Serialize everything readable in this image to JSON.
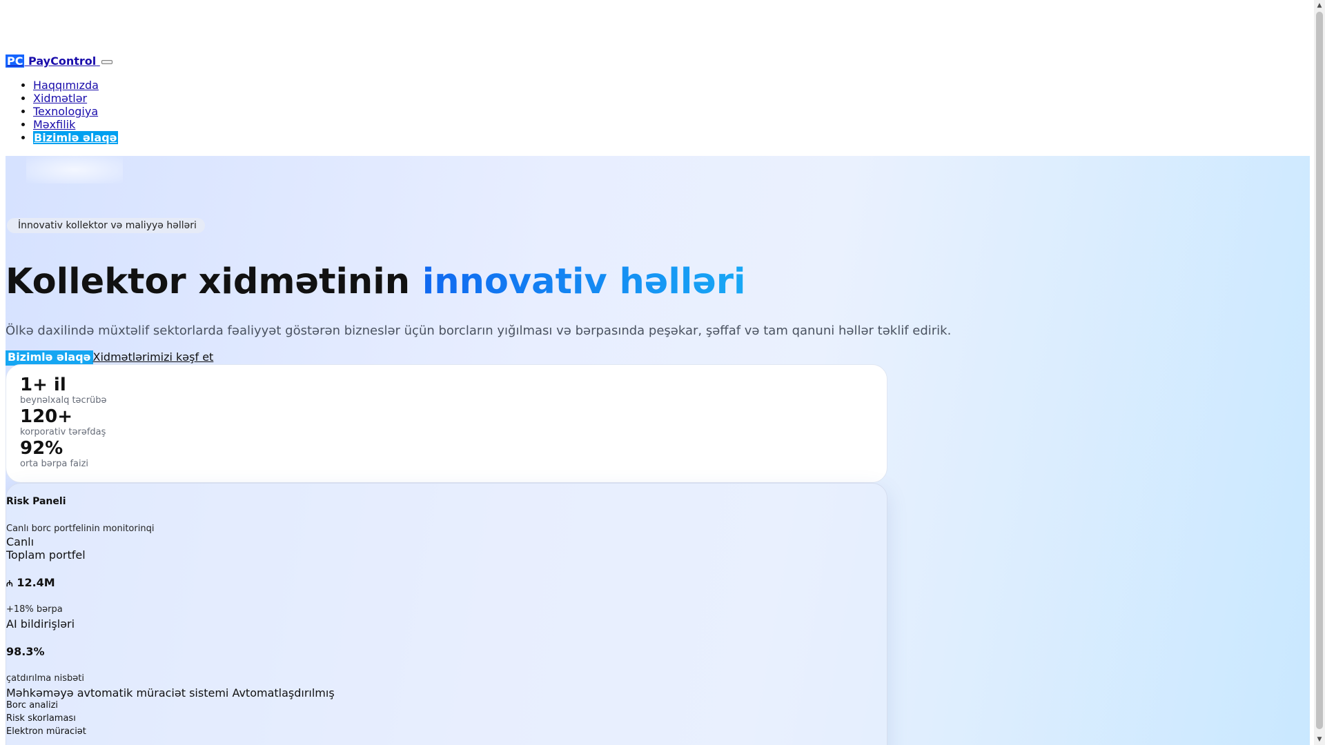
{
  "header": {
    "logo_mark": "PC",
    "logo_text": "PayControl",
    "nav": [
      {
        "label": "Haqqımızda"
      },
      {
        "label": "Xidmətlər"
      },
      {
        "label": "Texnologiya"
      },
      {
        "label": "Məxfilik"
      },
      {
        "label": "Bizimlə əlaqə"
      }
    ]
  },
  "hero": {
    "badge_icon": "",
    "badge": "İnnovativ kollektor və maliyyə həlləri",
    "title_main": "Kollektor xidmətinin ",
    "title_accent": "innovativ həlləri",
    "subtitle": "Ölkə daxilində müxtəlif sektorlarda fəaliyyət göstərən bizneslər üçün borcların yığılması və bərpasında peşəkar, şəffaf və tam qanuni həllər təklif edirik.",
    "cta_icon": "",
    "cta_primary": "Bizimlə əlaqə",
    "cta_secondary": "Xidmətlərimizi kəşf et"
  },
  "stats": [
    {
      "value": "1+ il",
      "label": "beynəlxalq təcrübə"
    },
    {
      "value": "120+",
      "label": "korporativ tərəfdaş"
    },
    {
      "value": "92%",
      "label": "orta bərpa faizi"
    }
  ],
  "risk_panel": {
    "title": "Risk Paneli",
    "subtitle": "Canlı borc portfelinin monitorinqi",
    "live": "Canlı",
    "metrics": [
      {
        "title": "Toplam portfel",
        "icon": "",
        "value_prefix": "₼",
        "value": "12.4M",
        "note_icon": "",
        "note": "+18% bərpa"
      },
      {
        "title": "AI bildirişləri",
        "icon": "",
        "value": "98.3%",
        "note": "çatdırılma nisbəti"
      }
    ],
    "feature": "Məhkəməyə avtomatik müraciət sistemi",
    "feature_tag": "Avtomatlaşdırılmış",
    "tags": [
      "Borc analizi",
      "Risk skorlaması",
      "Elektron müraciət"
    ]
  },
  "icons": {
    "scroll_up": "▲",
    "scroll_down": "▼"
  }
}
